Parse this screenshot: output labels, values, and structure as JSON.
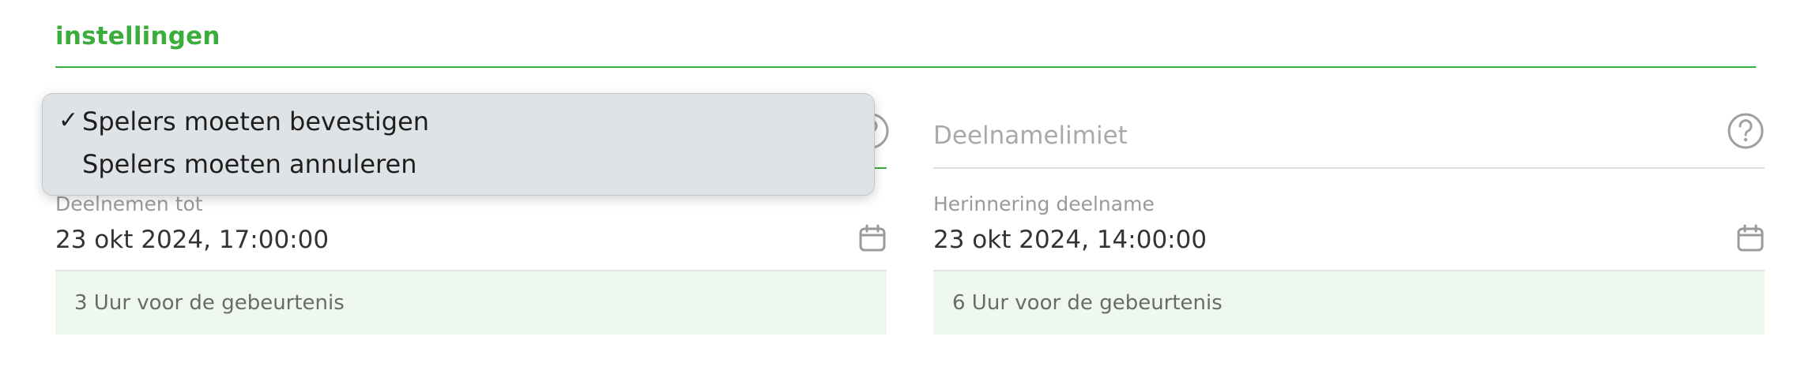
{
  "section": {
    "title": "instellingen"
  },
  "left": {
    "date_label": "Deelnemen tot",
    "date_value": "23 okt 2024, 17:00:00",
    "info": "3 Uur voor de gebeurtenis"
  },
  "right": {
    "select_placeholder": "Deelnamelimiet",
    "date_label": "Herinnering deelname",
    "date_value": "23 okt 2024, 14:00:00",
    "info": "6 Uur voor de gebeurtenis"
  },
  "popup": {
    "checkmark": "✓",
    "items": [
      {
        "label": "Spelers moeten bevestigen",
        "selected": true
      },
      {
        "label": "Spelers moeten annuleren",
        "selected": false
      }
    ]
  },
  "colors": {
    "accent": "#3aad3a",
    "info_background": "#eef8ee",
    "popup_background": "#e0e3e6"
  },
  "icons": {
    "help": "help-icon",
    "calendar": "calendar-icon"
  }
}
